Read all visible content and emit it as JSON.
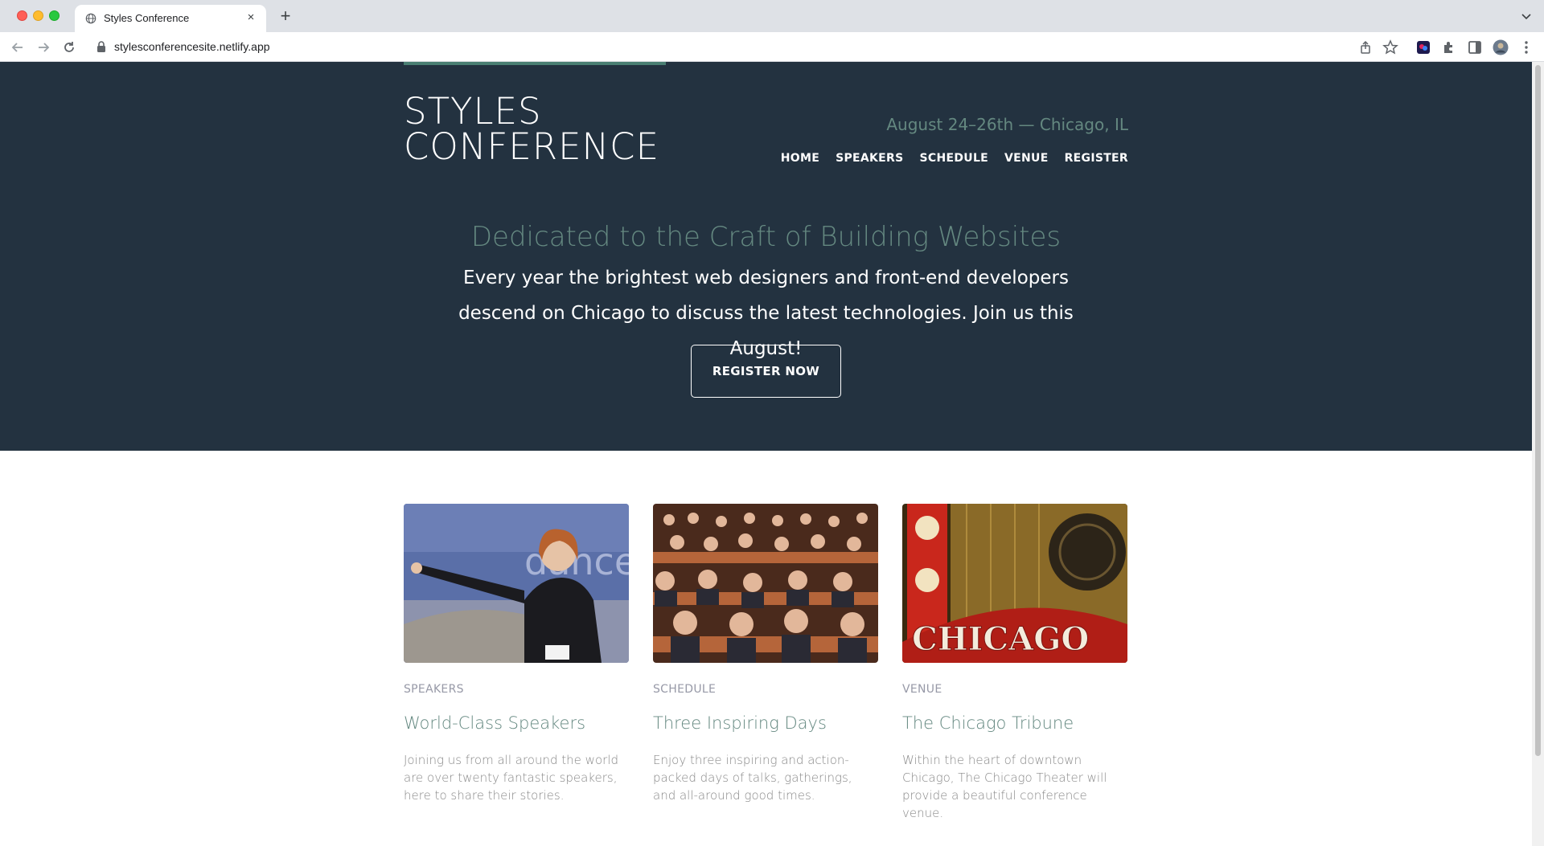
{
  "browser": {
    "tab_title": "Styles Conference",
    "new_tab_label": "+",
    "close_label": "×",
    "url": "stylesconferencesite.netlify.app"
  },
  "site": {
    "logo_line1": "STYLES",
    "logo_line2": "CONFERENCE",
    "dates": "August 24–26th — Chicago, IL",
    "nav": [
      "HOME",
      "SPEAKERS",
      "SCHEDULE",
      "VENUE",
      "REGISTER"
    ],
    "tagline": "Dedicated to the Craft of Building Websites",
    "lead": "Every year the brightest web designers and front-end developers descend on Chicago to discuss the latest technologies. Join us this August!",
    "cta": "REGISTER NOW"
  },
  "columns": [
    {
      "label": "SPEAKERS",
      "title": "World-Class Speakers",
      "text": "Joining us from all around the world are over twenty fantastic speakers, here to share their stories."
    },
    {
      "label": "SCHEDULE",
      "title": "Three Inspiring Days",
      "text": "Enjoy three inspiring and action-packed days of talks, gatherings, and all-around good times."
    },
    {
      "label": "VENUE",
      "title": "The Chicago Tribune",
      "text": "Within the heart of downtown Chicago, The Chicago Theater will provide a beautiful conference venue."
    }
  ],
  "images": {
    "speaker_slide_text": "dance",
    "venue_sign_text": "CHICAGO"
  },
  "colors": {
    "hero_bg": "#233240",
    "accent": "#648880",
    "muted": "#9799a7"
  }
}
